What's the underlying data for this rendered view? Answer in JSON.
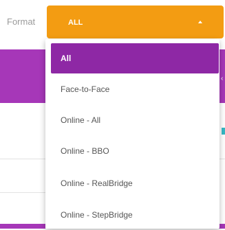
{
  "filter": {
    "label": "Format",
    "selected_value": "ALL",
    "options": [
      "All",
      "Face-to-Face",
      "Online - All",
      "Online - BBO",
      "Online - RealBridge",
      "Online - StepBridge"
    ],
    "highlighted_option": "All"
  },
  "colors": {
    "select_bg": "#f39c12",
    "highlight_bg": "#8e28a5",
    "page_accent": "#a637b8",
    "teal_accent": "#36b7c4"
  },
  "icons": {
    "select_caret": "caret-up-icon"
  }
}
